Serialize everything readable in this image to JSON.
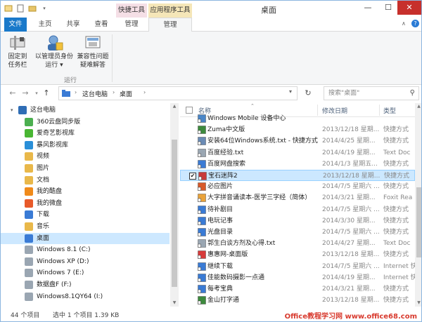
{
  "window": {
    "title": "桌面",
    "controls": {
      "minimize": "—",
      "maximize": "☐",
      "close": "✕"
    }
  },
  "quick_access": [
    "properties-icon",
    "new-folder-icon",
    "save-icon"
  ],
  "context_groups": {
    "shortcut_tools": "快捷工具",
    "app_tools": "应用程序工具"
  },
  "tabs": {
    "file": "文件",
    "home": "主页",
    "share": "共享",
    "view": "查看",
    "manage1": "管理",
    "manage2": "管理"
  },
  "ribbon": {
    "pin_label": "固定到\n任务栏",
    "admin_label": "以管理员身份\n运行 ▾",
    "compat_label": "兼容性问题\n疑难解答",
    "group_label": "运行"
  },
  "address": {
    "crumb1": "这台电脑",
    "crumb2": "桌面",
    "search_placeholder": "搜索\"桌面\""
  },
  "nav_pane": {
    "items": [
      {
        "label": "这台电脑",
        "icon": "pc-icon",
        "top": true,
        "color": "#2f6db5"
      },
      {
        "label": "360云盘同步版",
        "icon": "cloud-icon",
        "color": "#4caf50"
      },
      {
        "label": "爱奇艺影视库",
        "icon": "iqiyi-icon",
        "color": "#49b633"
      },
      {
        "label": "暴风影视库",
        "icon": "baofeng-icon",
        "color": "#2a8fd8"
      },
      {
        "label": "视频",
        "icon": "video-folder-icon",
        "color": "#e9b84a"
      },
      {
        "label": "图片",
        "icon": "pictures-folder-icon",
        "color": "#e9b84a"
      },
      {
        "label": "文档",
        "icon": "documents-folder-icon",
        "color": "#e9b84a"
      },
      {
        "label": "我的酷盘",
        "icon": "kupan-icon",
        "color": "#f08a1a"
      },
      {
        "label": "我的微盘",
        "icon": "weipan-icon",
        "color": "#e85a2a"
      },
      {
        "label": "下载",
        "icon": "downloads-folder-icon",
        "color": "#3a7bd5"
      },
      {
        "label": "音乐",
        "icon": "music-folder-icon",
        "color": "#e9b84a"
      },
      {
        "label": "桌面",
        "icon": "desktop-folder-icon",
        "color": "#3a7bd5",
        "selected": true
      },
      {
        "label": "Windows 8.1 (C:)",
        "icon": "drive-icon",
        "color": "#9aa6b2"
      },
      {
        "label": "Windows XP (D:)",
        "icon": "drive-icon",
        "color": "#9aa6b2"
      },
      {
        "label": "Windows 7 (E:)",
        "icon": "drive-icon",
        "color": "#9aa6b2"
      },
      {
        "label": "数据盘F (F:)",
        "icon": "drive-icon",
        "color": "#9aa6b2"
      },
      {
        "label": "Windows8.1QY64 (I:)",
        "icon": "drive-icon",
        "color": "#9aa6b2"
      }
    ]
  },
  "file_list": {
    "headers": {
      "name": "名称",
      "date": "修改日期",
      "type": "类型"
    },
    "rows": [
      {
        "name": "Windows Mobile 设备中心",
        "date": "",
        "type": "",
        "icon": "shortcut-icon",
        "color": "#4a86c8"
      },
      {
        "name": "Zuma中文版",
        "date": "2013/12/18 星期...",
        "type": "快捷方式",
        "icon": "shortcut-icon",
        "color": "#3d8a3d"
      },
      {
        "name": "安装64位Windows系统.txt - 快捷方式",
        "date": "2014/4/25 星期...",
        "type": "快捷方式",
        "icon": "shortcut-icon",
        "color": "#6a8bb5"
      },
      {
        "name": "百度经验.txt",
        "date": "2014/4/19 星期...",
        "type": "Text Doc",
        "icon": "text-file-icon",
        "color": "#9aa6b2"
      },
      {
        "name": "百度网盘搜索",
        "date": "2014/1/3 星期五...",
        "type": "快捷方式",
        "icon": "shortcut-icon",
        "color": "#3a7bd5"
      },
      {
        "name": "宝石迷阵2",
        "date": "2013/12/18 星期...",
        "type": "快捷方式",
        "icon": "bejeweled-icon",
        "color": "#c83a3a",
        "selected": true,
        "checked": "✔"
      },
      {
        "name": "必应图片",
        "date": "2014/7/5 星期六 ...",
        "type": "快捷方式",
        "icon": "shortcut-icon",
        "color": "#d85a2a"
      },
      {
        "name": "大字拼音诵读本-医学三字经（简体）",
        "date": "2014/3/21 星期...",
        "type": "Foxit Rea",
        "icon": "pdf-icon",
        "color": "#e9a23a"
      },
      {
        "name": "待补剧目",
        "date": "2014/7/5 星期六 ...",
        "type": "快捷方式",
        "icon": "shortcut-icon",
        "color": "#3a7bd5"
      },
      {
        "name": "电玩记事",
        "date": "2014/3/30 星期...",
        "type": "快捷方式",
        "icon": "shortcut-icon",
        "color": "#3a7bd5"
      },
      {
        "name": "光盘目录",
        "date": "2014/7/5 星期六 ...",
        "type": "快捷方式",
        "icon": "shortcut-icon",
        "color": "#3a7bd5"
      },
      {
        "name": "郭生白谈方剂及心得.txt",
        "date": "2014/4/27 星期...",
        "type": "Text Doc",
        "icon": "text-file-icon",
        "color": "#9aa6b2"
      },
      {
        "name": "惠惠网-桌面版",
        "date": "2013/12/18 星期...",
        "type": "快捷方式",
        "icon": "shortcut-icon",
        "color": "#d83a3a"
      },
      {
        "name": "继续下载",
        "date": "2014/7/5 星期六 ...",
        "type": "Internet 快",
        "icon": "internet-shortcut-icon",
        "color": "#3a7bd5"
      },
      {
        "name": "佳能数码摄影一点通",
        "date": "2014/4/19 星期...",
        "type": "Internet 快",
        "icon": "internet-shortcut-icon",
        "color": "#3a7bd5"
      },
      {
        "name": "每考宝典",
        "date": "2014/3/21 星期...",
        "type": "快捷方式",
        "icon": "shortcut-icon",
        "color": "#3a7bd5"
      },
      {
        "name": "金山打字通",
        "date": "2013/12/18 星期...",
        "type": "快捷方式",
        "icon": "shortcut-icon",
        "color": "#3d8a3d"
      },
      {
        "name": "",
        "date": "",
        "type": "",
        "icon": "shortcut-icon",
        "color": "#3a7bd5"
      }
    ]
  },
  "status_bar": {
    "item_count": "44 个项目",
    "selection": "选中 1 个项目  1.39 KB",
    "watermark": "Office教程学习网 www.office68.com"
  }
}
